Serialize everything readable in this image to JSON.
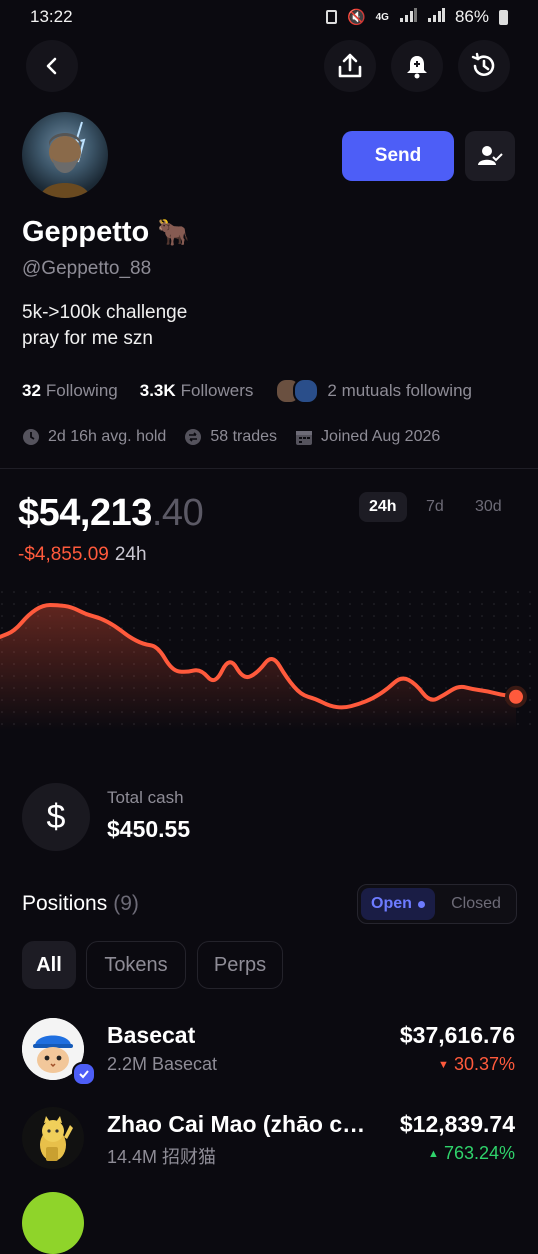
{
  "status_bar": {
    "time": "13:22",
    "battery": "86%",
    "network": "4G"
  },
  "nav": {
    "back_icon": "chevron-left-icon",
    "share_icon": "share-icon",
    "bell_icon": "bell-icon",
    "history_icon": "history-icon"
  },
  "profile": {
    "name": "Geppetto",
    "emoji": "🐂",
    "handle": "@Geppetto_88",
    "bio_line1": "5k->100k challenge",
    "bio_line2": "pray for me szn",
    "following_count": "32",
    "following_label": "Following",
    "followers_count": "3.3K",
    "followers_label": "Followers",
    "mutuals": "2 mutuals following",
    "avg_hold": "2d 16h avg. hold",
    "trades": "58 trades",
    "joined": "Joined Aug 2026",
    "send_label": "Send"
  },
  "portfolio": {
    "balance_main": "$54,213",
    "balance_decimal": ".40",
    "change_value": "-$4,855.09",
    "change_period": "24h",
    "ranges": [
      "24h",
      "7d",
      "30d"
    ],
    "active_range": "24h",
    "accent_down": "#ff5a3c"
  },
  "chart_data": {
    "type": "line",
    "series": [
      {
        "values": [
          58,
          61,
          70,
          75,
          75,
          74,
          70,
          68,
          64,
          58,
          54,
          53,
          40,
          39,
          41,
          32,
          48,
          35,
          39,
          49,
          36,
          27,
          25,
          21,
          20,
          22,
          25,
          30,
          37,
          33,
          23,
          27,
          32,
          30,
          29,
          27,
          26
        ]
      }
    ]
  },
  "cash": {
    "label": "Total cash",
    "value": "$450.55",
    "icon": "dollar-icon"
  },
  "positions": {
    "title": "Positions",
    "count": "(9)",
    "toggle_open": "Open",
    "toggle_closed": "Closed",
    "filters": [
      "All",
      "Tokens",
      "Perps"
    ],
    "active_filter": "All",
    "items": [
      {
        "name": "Basecat",
        "amount": "2.2M Basecat",
        "value": "$37,616.76",
        "change": "30.37%",
        "direction": "down"
      },
      {
        "name": "Zhao Cai Mao (zhāo cái māo)",
        "amount": "14.4M 招财猫",
        "value": "$12,839.74",
        "change": "763.24%",
        "direction": "up"
      }
    ]
  }
}
